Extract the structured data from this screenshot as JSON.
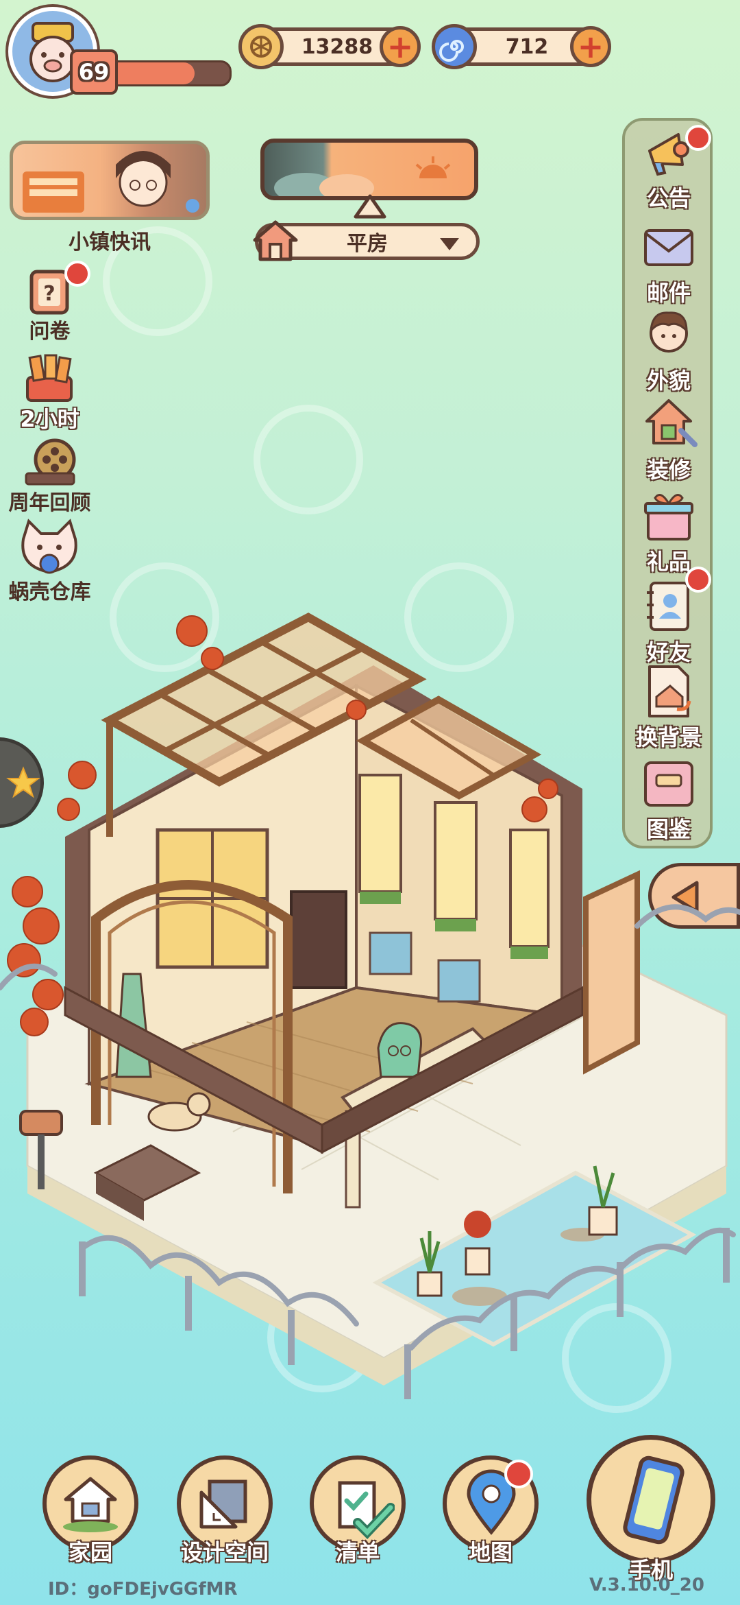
{
  "player": {
    "level": "69",
    "avatar": "pig-avatar",
    "xp_fraction": 0.72
  },
  "currency": {
    "coins": {
      "icon": "coin-icon",
      "amount": "13288"
    },
    "shells": {
      "icon": "snail-shell-icon",
      "amount": "712"
    }
  },
  "news": {
    "label": "小镇快讯"
  },
  "house": {
    "type": "平房"
  },
  "left_menu": [
    {
      "id": "questionnaire",
      "icon": "questionnaire-icon",
      "label": "问卷",
      "badge": true
    },
    {
      "id": "limited",
      "icon": "gift-box-icon",
      "label": "2小时",
      "badge": false
    },
    {
      "id": "anniversary",
      "icon": "film-reel-icon",
      "label": "周年回顾",
      "badge": false
    },
    {
      "id": "warehouse",
      "icon": "cat-icon",
      "label": "蜗壳仓库",
      "badge": false
    }
  ],
  "right_menu": [
    {
      "id": "announcement",
      "icon": "megaphone-icon",
      "label": "公告",
      "badge": true
    },
    {
      "id": "mail",
      "icon": "mail-icon",
      "label": "邮件",
      "badge": false
    },
    {
      "id": "appearance",
      "icon": "person-icon",
      "label": "外貌",
      "badge": false
    },
    {
      "id": "decorate",
      "icon": "house-wrench-icon",
      "label": "装修",
      "badge": false
    },
    {
      "id": "gift",
      "icon": "gift-icon",
      "label": "礼品",
      "badge": false
    },
    {
      "id": "friends",
      "icon": "contacts-book-icon",
      "label": "好友",
      "badge": true
    },
    {
      "id": "background",
      "icon": "background-swap-icon",
      "label": "换背景",
      "badge": false
    },
    {
      "id": "catalog",
      "icon": "catalog-book-icon",
      "label": "图鉴",
      "badge": false
    }
  ],
  "bottom_nav": [
    {
      "id": "home",
      "icon": "home-icon",
      "label": "家园",
      "badge": false
    },
    {
      "id": "design",
      "icon": "ruler-icon",
      "label": "设计空间",
      "badge": false
    },
    {
      "id": "checklist",
      "icon": "checklist-icon",
      "label": "清单",
      "badge": false
    },
    {
      "id": "map",
      "icon": "map-pin-icon",
      "label": "地图",
      "badge": true
    },
    {
      "id": "phone",
      "icon": "phone-icon",
      "label": "手机",
      "badge": false
    }
  ],
  "footer": {
    "id": "ID：goFDEjvGGfMR",
    "version": "V.3.10.0_20"
  },
  "colors": {
    "outline": "#5a3a2e",
    "badge": "#e0463c",
    "wood": "#b0703f",
    "cream": "#fbe8cf"
  }
}
